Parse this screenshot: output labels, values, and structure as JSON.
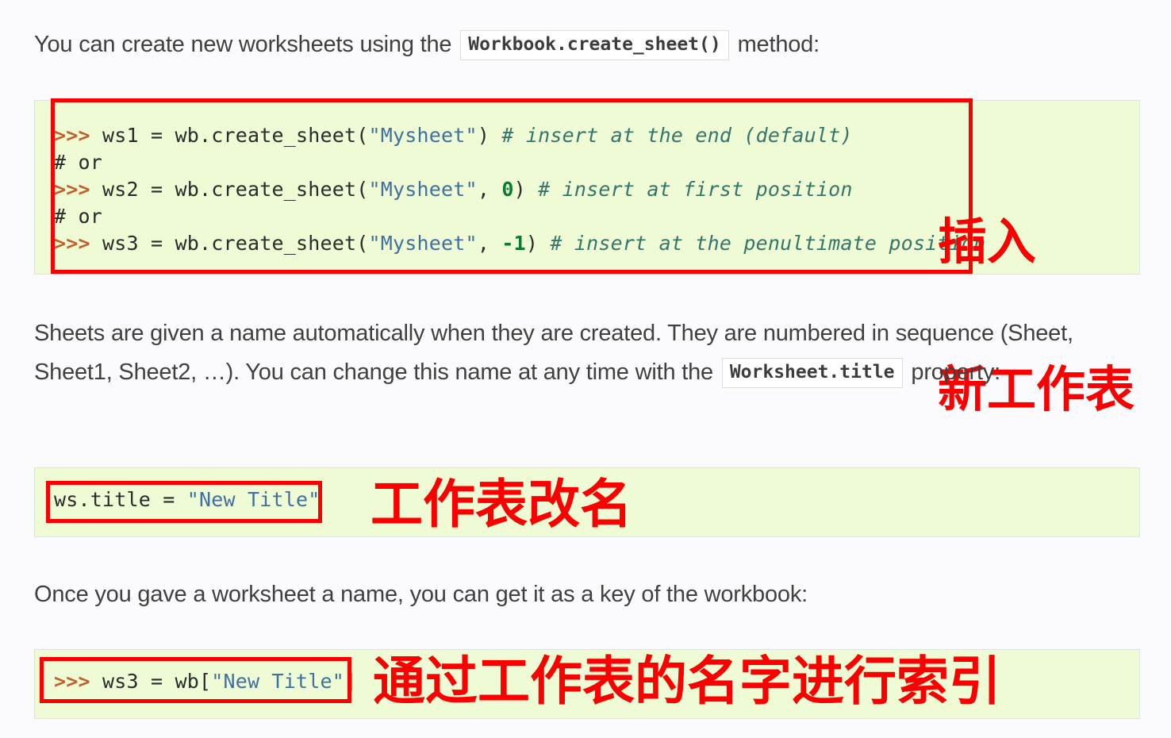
{
  "document": {
    "paragraph_1": {
      "before": "You can create new worksheets using the",
      "code": "Workbook.create_sheet()",
      "after": "method:"
    },
    "paragraph_2": {
      "before": "Sheets are given a name automatically when they are created. They are numbered in sequence (Sheet, Sheet1, Sheet2, …). You can change this name at any time with the",
      "code": "Worksheet.title",
      "after": "property:"
    },
    "paragraph_3": {
      "text": "Once you gave a worksheet a name, you can get it as a key of the workbook:"
    }
  },
  "code_blocks": {
    "block_1": {
      "lines": [
        {
          "prompt": ">>> ",
          "plain": "ws1 = wb.create_sheet(",
          "string": "\"Mysheet\"",
          "plain2": ") ",
          "comment": "# insert at the end (default)"
        },
        {
          "prompt": "",
          "plain": "# or",
          "string": "",
          "plain2": "",
          "comment": ""
        },
        {
          "prompt": ">>> ",
          "plain": "ws2 = wb.create_sheet(",
          "string": "\"Mysheet\"",
          "plain2": ", ",
          "number": "0",
          "plain3": ") ",
          "comment": "# insert at first position"
        },
        {
          "prompt": "",
          "plain": "# or",
          "string": "",
          "plain2": "",
          "comment": ""
        },
        {
          "prompt": ">>> ",
          "plain": "ws3 = wb.create_sheet(",
          "string": "\"Mysheet\"",
          "plain2": ", ",
          "number": "-1",
          "plain3": ") ",
          "comment": "# insert at the penultimate position"
        }
      ]
    },
    "block_2": {
      "line": {
        "plain": "ws.title = ",
        "string": "\"New Title\""
      }
    },
    "block_3": {
      "line": {
        "prompt": ">>> ",
        "plain": "ws3 = wb[",
        "string": "\"New Title\"",
        "plain2": "]"
      }
    }
  },
  "annotations": {
    "insert_new_sheet": {
      "line_1": "插入",
      "line_2": "新工作表"
    },
    "rename_sheet": "工作表改名",
    "index_by_name": "通过工作表的名字进行索引"
  },
  "colors": {
    "page_background": "#fbfbfd",
    "code_background": "#eefbd4",
    "annotation_red": "#fb0000",
    "prompt_orange": "#c0622b",
    "string_blue": "#4070a0",
    "comment_teal": "#36756b",
    "number_green": "#0a7a35",
    "text_gray": "#404040"
  }
}
